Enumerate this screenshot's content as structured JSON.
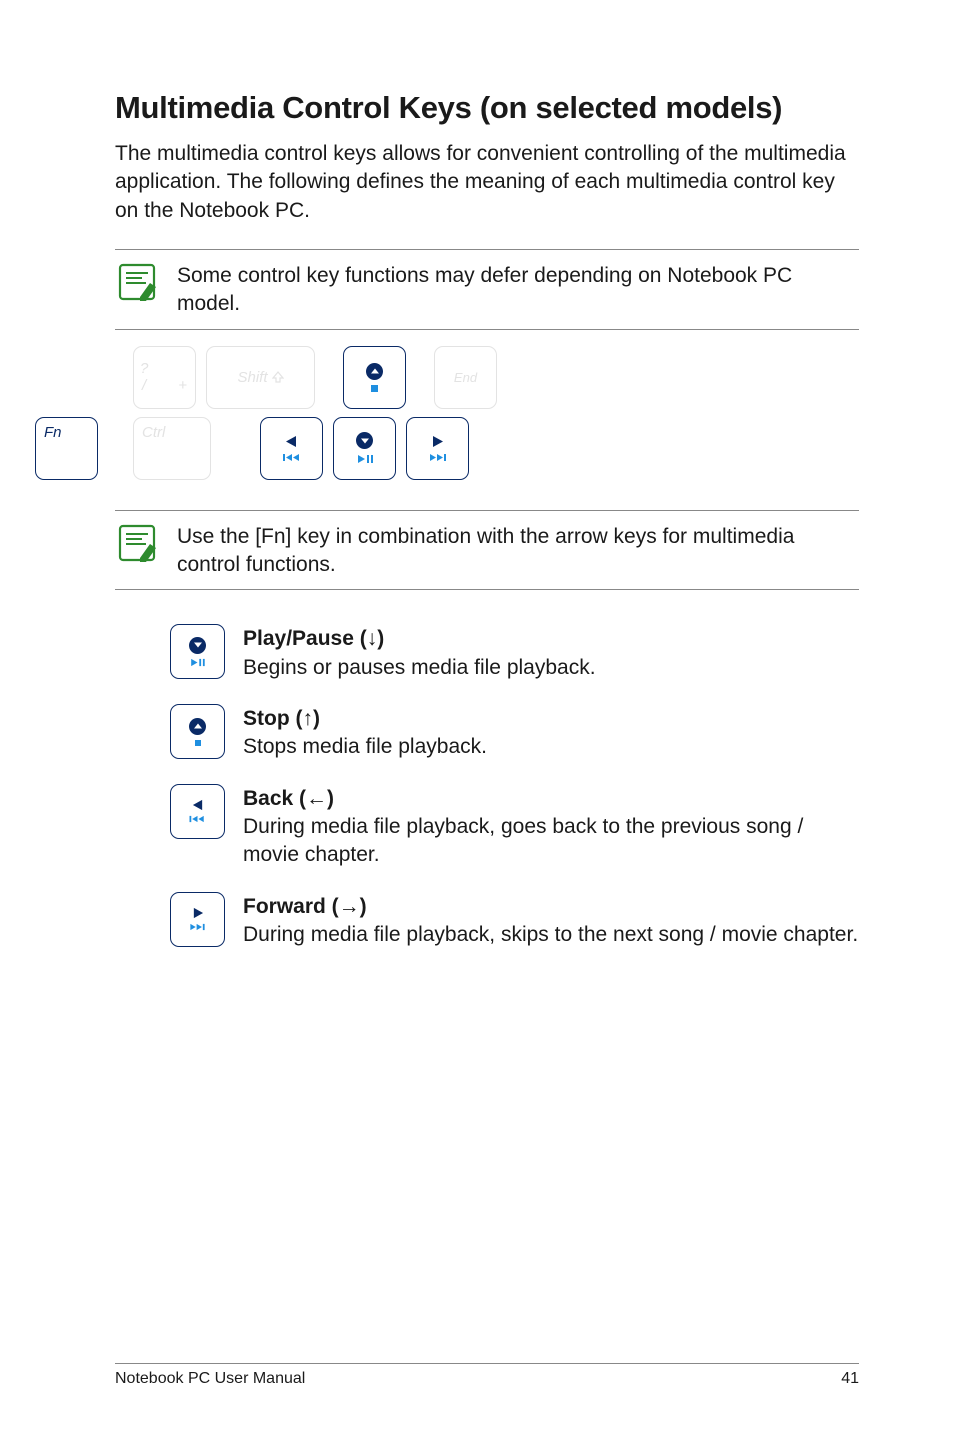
{
  "heading": "Multimedia Control Keys (on selected models)",
  "intro": "The multimedia control keys allows for convenient controlling of the multimedia application. The following defines the meaning of each multimedia control key on the Notebook PC.",
  "note1": "Some control key functions may defer depending on Notebook PC model.",
  "note2": "Use the [Fn] key in combination with the arrow keys for multimedia control functions.",
  "keys": {
    "fn": "Fn",
    "ctrl": "Ctrl",
    "shift": "Shift",
    "end": "End",
    "slash_top": "?",
    "slash_bot_left": "/",
    "slash_bot_right": "+"
  },
  "functions": [
    {
      "title": "Play/Pause (↓)",
      "desc": "Begins or pauses media file playback."
    },
    {
      "title": "Stop (↑)",
      "desc": "Stops media file playback."
    },
    {
      "title": "Back (←)",
      "desc": "During media file playback, goes back to the previous song / movie chapter."
    },
    {
      "title": "Forward (→)",
      "desc": "During media file playback, skips to the next song / movie chapter."
    }
  ],
  "footer": {
    "left": "Notebook PC User Manual",
    "right": "41"
  }
}
